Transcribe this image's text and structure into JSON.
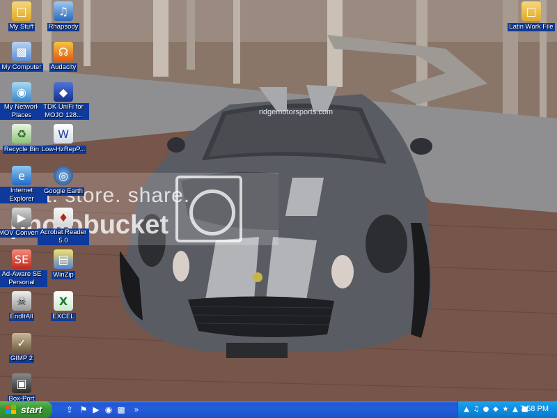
{
  "desktop": {
    "icons": [
      {
        "label": "My Stuff",
        "icon": "folder-icon"
      },
      {
        "label": "Rhapsody",
        "icon": "rhapsody-icon"
      },
      {
        "label": "My Computer",
        "icon": "computer-icon"
      },
      {
        "label": "Audacity",
        "icon": "audacity-icon"
      },
      {
        "label": "My Network Places",
        "icon": "network-places-icon"
      },
      {
        "label": "TDK UniFi for MOJO 128...",
        "icon": "tdk-icon"
      },
      {
        "label": "Recycle Bin",
        "icon": "recycle-bin-icon"
      },
      {
        "label": "Low-HzRepP...",
        "icon": "word-document-icon"
      },
      {
        "label": "Internet Explorer",
        "icon": "internet-explorer-icon"
      },
      {
        "label": "Google Earth",
        "icon": "google-earth-icon"
      },
      {
        "label": "MOV Converter",
        "icon": "mov-converter-icon"
      },
      {
        "label": "Acrobat Reader 5.0",
        "icon": "acrobat-icon"
      },
      {
        "label": "Ad-Aware SE Personal",
        "icon": "ad-aware-icon"
      },
      {
        "label": "WinZip",
        "icon": "winzip-icon"
      },
      {
        "label": "EndItAll",
        "icon": "skull-icon"
      },
      {
        "label": "EXCEL",
        "icon": "excel-icon"
      },
      {
        "label": "GIMP 2",
        "icon": "gimp-icon"
      },
      {
        "label": "Box-Port",
        "icon": "box-port-icon"
      },
      {
        "label": "Latin Work File",
        "icon": "folder-icon"
      }
    ]
  },
  "wallpaper": {
    "windshield_banner": "ridgemotorsports.com",
    "watermark_line1": "host. store. share.",
    "watermark_line2": "photobucket"
  },
  "taskbar": {
    "start_label": "start",
    "quick_launch": [
      "show-desktop-icon",
      "runner-icon",
      "media-icon",
      "browser-icon",
      "messenger-icon"
    ],
    "tray_icons": [
      "network-icon",
      "volume-icon",
      "security-icon",
      "antivirus-icon",
      "update-icon",
      "bluetooth-icon",
      "shield-icon"
    ],
    "clock": "7:58 PM"
  },
  "colors": {
    "taskbar_blue": "#245edb",
    "start_green": "#3c9a35",
    "tray_blue": "#0f8de0",
    "label_highlight": "#0d3a9c"
  }
}
